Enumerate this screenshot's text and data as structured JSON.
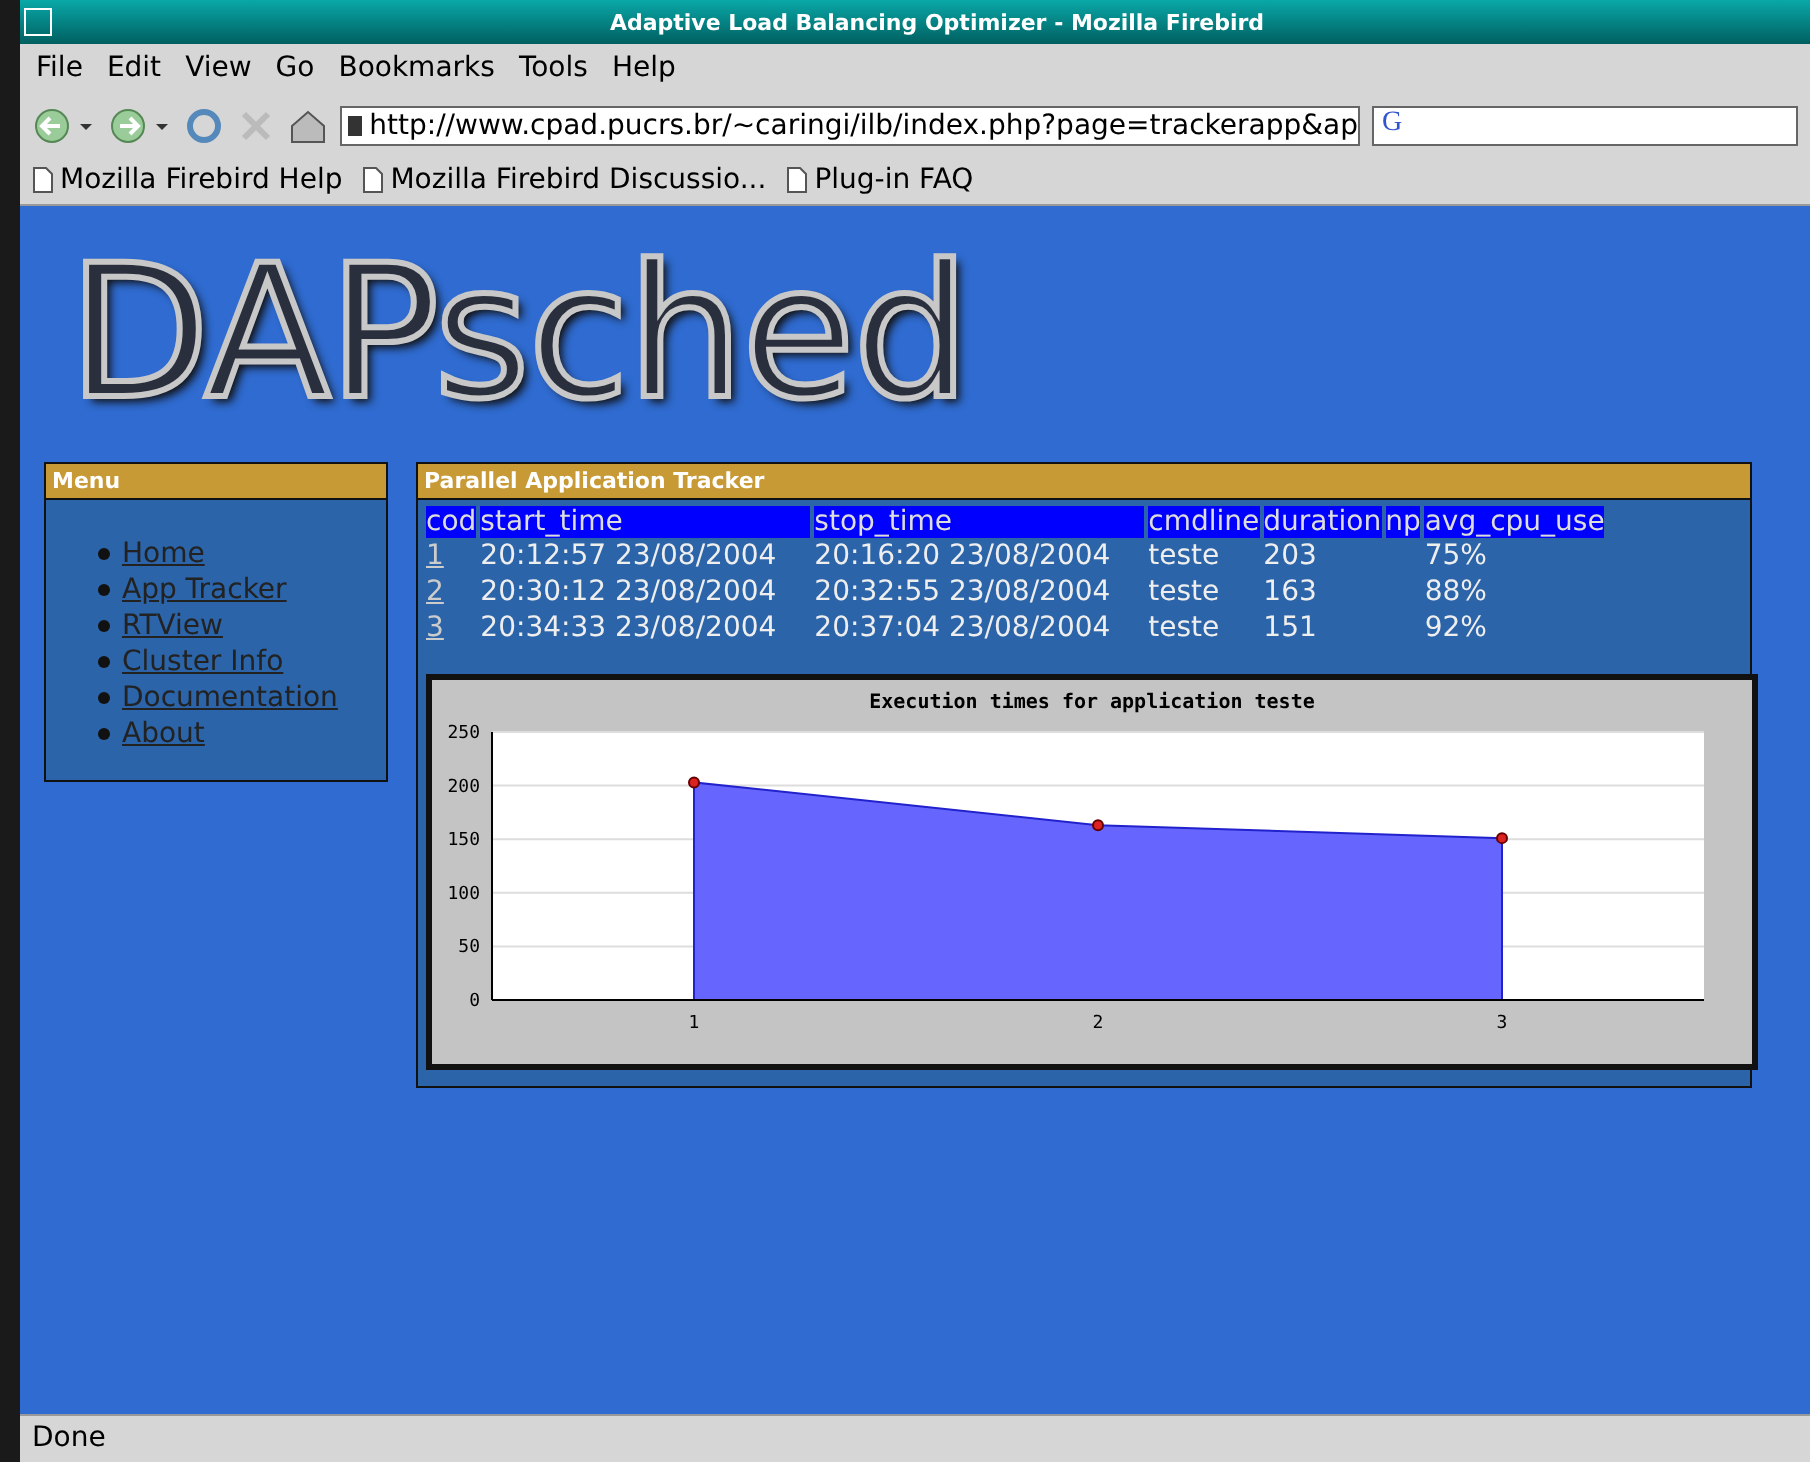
{
  "window": {
    "title": "Adaptive Load Balancing Optimizer - Mozilla Firebird"
  },
  "menu_bar": [
    "File",
    "Edit",
    "View",
    "Go",
    "Bookmarks",
    "Tools",
    "Help"
  ],
  "address_bar": {
    "value": "http://www.cpad.pucrs.br/~caringi/ilb/index.php?page=trackerapp&ap"
  },
  "search_field": {
    "value": "G"
  },
  "bookmarks": [
    "Mozilla Firebird Help",
    "Mozilla Firebird Discussio...",
    "Plug-in FAQ"
  ],
  "page": {
    "logo": "DAPsched",
    "menu": {
      "title": "Menu",
      "items": [
        "Home",
        "App Tracker",
        "RTView",
        "Cluster Info",
        "Documentation",
        "About"
      ]
    },
    "tracker": {
      "title": "Parallel Application Tracker",
      "table": {
        "columns": [
          "cod",
          "start_time",
          "stop_time",
          "cmdline",
          "duration",
          "np",
          "avg_cpu_use"
        ],
        "rows": [
          [
            "1",
            "20:12:57 23/08/2004",
            "20:16:20 23/08/2004",
            "teste",
            "203",
            "",
            "75%"
          ],
          [
            "2",
            "20:30:12 23/08/2004",
            "20:32:55 23/08/2004",
            "teste",
            "163",
            "",
            "88%"
          ],
          [
            "3",
            "20:34:33 23/08/2004",
            "20:37:04 23/08/2004",
            "teste",
            "151",
            "",
            "92%"
          ]
        ]
      },
      "chart_data": {
        "type": "area",
        "title": "Execution times for application teste",
        "categories": [
          "1",
          "2",
          "3"
        ],
        "series": [
          {
            "color": "#6666ff",
            "values": [
              203,
              163,
              151
            ]
          }
        ],
        "grid": true,
        "ylim": [
          0,
          250
        ],
        "yticks": [
          0,
          50,
          100,
          150,
          200,
          250
        ]
      }
    }
  },
  "status_bar": "Done"
}
